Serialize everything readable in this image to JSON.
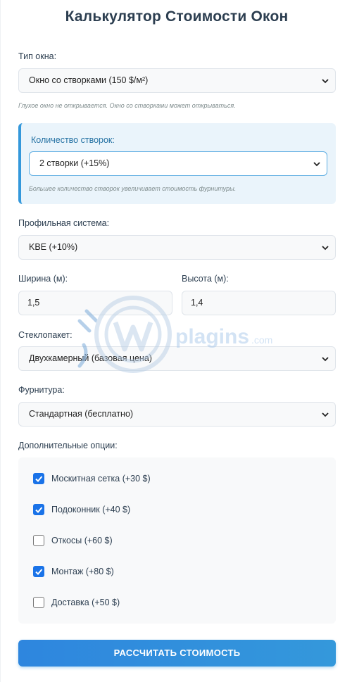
{
  "title": "Калькулятор Стоимости Окон",
  "window_type": {
    "label": "Тип окна:",
    "value": "Окно со створками (150 $/м²)",
    "hint": "Глухое окно не открывается. Окно со створками может открываться."
  },
  "sashes": {
    "label": "Количество створок:",
    "value": "2 створки (+15%)",
    "hint": "Большее количество створок увеличивает стоимость фурнитуры."
  },
  "profile": {
    "label": "Профильная система:",
    "value": "KBE (+10%)"
  },
  "width": {
    "label": "Ширина (м):",
    "value": "1,5"
  },
  "height": {
    "label": "Высота (м):",
    "value": "1,4"
  },
  "glass": {
    "label": "Стеклопакет:",
    "value": "Двухкамерный (базовая цена)"
  },
  "hardware": {
    "label": "Фурнитура:",
    "value": "Стандартная (бесплатно)"
  },
  "extras": {
    "label": "Дополнительные опции:",
    "items": [
      {
        "label": "Москитная сетка (+30 $)",
        "checked": true
      },
      {
        "label": "Подоконник (+40 $)",
        "checked": true
      },
      {
        "label": "Откосы (+60 $)",
        "checked": false
      },
      {
        "label": "Монтаж (+80 $)",
        "checked": true
      },
      {
        "label": "Доставка (+50 $)",
        "checked": false
      }
    ]
  },
  "calculate_button": "РАССЧИТАТЬ СТОИМОСТЬ",
  "watermark": {
    "text_main": "plagins",
    "text_suffix": ".com"
  },
  "colors": {
    "accent": "#3498db",
    "checkbox": "#1a73e8",
    "title": "#2c3e50"
  }
}
